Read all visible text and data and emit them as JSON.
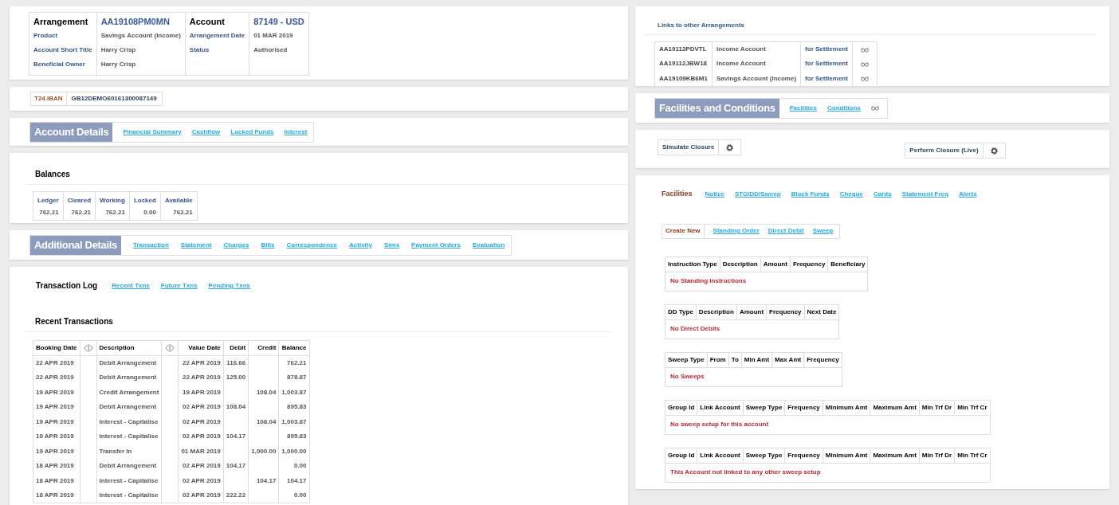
{
  "summary": {
    "blocks": [
      {
        "title": "Arrangement",
        "value": "AA19108PM0MN",
        "rows": [
          {
            "label": "Product",
            "value": "Savings Account (Income)"
          },
          {
            "label": "Account Short Title",
            "value": "Harry Crisp"
          },
          {
            "label": "Beneficial Owner",
            "value": "Harry Crisp"
          }
        ]
      },
      {
        "title": "Account",
        "value": "87149 - USD",
        "rows": [
          {
            "label": "Arrangement Date",
            "value": "01 MAR 2019"
          },
          {
            "label": "Status",
            "value": "Authorised"
          }
        ]
      }
    ]
  },
  "iban": {
    "label": "T24.IBAN",
    "value": "GB12DEMO60161300087149"
  },
  "account_details": {
    "title": "Account Details",
    "links": [
      "Financial Summary",
      "Cashflow",
      "Locked Funds",
      "Interest"
    ]
  },
  "balances": {
    "title": "Balances",
    "columns": [
      {
        "label": "Ledger",
        "value": "762.21"
      },
      {
        "label": "Cleared",
        "value": "762.21"
      },
      {
        "label": "Working",
        "value": "762.21"
      },
      {
        "label": "Locked",
        "value": "0.00"
      },
      {
        "label": "Available",
        "value": "762.21"
      }
    ]
  },
  "additional_details": {
    "title": "Additional Details",
    "links": [
      "Transaction",
      "Statement",
      "Charges",
      "Bills",
      "Correspondence",
      "Activity",
      "Sims",
      "Payment Orders",
      "Evaluation"
    ]
  },
  "transaction_log": {
    "title": "Transaction Log",
    "links": [
      "Recent Txns",
      "Future Txns",
      "Pending Txns"
    ],
    "recent": {
      "title": "Recent Transactions",
      "columns": {
        "booking_date": "Booking Date",
        "description": "Description",
        "value_date": "Value Date",
        "debit": "Debit",
        "credit": "Credit",
        "balance": "Balance"
      },
      "rows": [
        {
          "booking_date": "22 APR 2019",
          "description": "Debit Arrangement",
          "value_date": "22 APR 2019",
          "debit": "116.66",
          "balance": "762.21"
        },
        {
          "booking_date": "22 APR 2019",
          "description": "Debit Arrangement",
          "value_date": "22 APR 2019",
          "debit": "125.00",
          "balance": "878.87"
        },
        {
          "booking_date": "19 APR 2019",
          "description": "Credit Arrangement",
          "value_date": "19 APR 2019",
          "credit": "108.04",
          "balance": "1,003.87"
        },
        {
          "booking_date": "19 APR 2019",
          "description": "Debit Arrangement",
          "value_date": "02 APR 2019",
          "debit": "108.04",
          "balance": "895.83"
        },
        {
          "booking_date": "19 APR 2019",
          "description": "Interest - Capitalise",
          "value_date": "02 APR 2019",
          "credit": "108.04",
          "balance": "1,003.87"
        },
        {
          "booking_date": "19 APR 2019",
          "description": "Interest - Capitalise",
          "value_date": "02 APR 2019",
          "debit": "104.17",
          "balance": "895.83"
        },
        {
          "booking_date": "19 APR 2019",
          "description": "Transfer In",
          "value_date": "01 MAR 2019",
          "credit": "1,000.00",
          "balance": "1,000.00"
        },
        {
          "booking_date": "18 APR 2019",
          "description": "Debit Arrangement",
          "value_date": "02 APR 2019",
          "debit": "104.17",
          "balance": "0.00"
        },
        {
          "booking_date": "18 APR 2019",
          "description": "Interest - Capitalise",
          "value_date": "02 APR 2019",
          "credit": "104.17",
          "balance": "104.17"
        },
        {
          "booking_date": "18 APR 2019",
          "description": "Interest - Capitalise",
          "value_date": "02 APR 2019",
          "debit": "222.22",
          "balance": "0.00"
        }
      ]
    }
  },
  "linked_arrangements": {
    "title": "Links to other Arrangements",
    "rows": [
      {
        "arrangement": "AA19112PDVTL",
        "product": "Income Account",
        "role": "for Settlement"
      },
      {
        "arrangement": "AA19112JBW18",
        "product": "Income Account",
        "role": "for Settlement"
      },
      {
        "arrangement": "AA19109KB6M1",
        "product": "Savings Account (Income)",
        "role": "for Settlement"
      }
    ]
  },
  "facilities_conditions": {
    "title": "Facilities and Conditions",
    "links": [
      "Facilities",
      "Conditions"
    ]
  },
  "closure": {
    "buttons": [
      "Simulate Closure",
      "Perform Closure (Live)"
    ]
  },
  "facilities": {
    "title": "Facilities",
    "links": [
      "Notice",
      "STO/DD/Sweep",
      "Block Funds",
      "Cheque",
      "Cards",
      "Statement Freq",
      "Alerts"
    ],
    "create_new": {
      "label": "Create New",
      "links": [
        "Standing Order",
        "Direct Debit",
        "Sweep"
      ]
    },
    "tables": [
      {
        "columns": [
          "Instruction Type",
          "Description",
          "Amount",
          "Frequency",
          "Beneficiary"
        ],
        "message": "No Standing Instructions"
      },
      {
        "columns": [
          "DD Type",
          "Description",
          "Amount",
          "Frequency",
          "Next Date"
        ],
        "message": "No Direct Debits"
      },
      {
        "columns": [
          "Sweep Type",
          "From",
          "To",
          "Min Amt",
          "Max Amt",
          "Frequency"
        ],
        "message": "No Sweeps"
      },
      {
        "columns": [
          "Group Id",
          "Link Account",
          "Sweep Type",
          "Frequency",
          "Minimum Amt",
          "Maximum Amt",
          "Min Trf Dr",
          "Min Trf Cr"
        ],
        "message": "No sweep setup for this account"
      },
      {
        "columns": [
          "Group Id",
          "Link Account",
          "Sweep Type",
          "Frequency",
          "Minimum Amt",
          "Maximum Amt",
          "Min Trf Dr",
          "Min Trf Cr"
        ],
        "message": "This Account not linked to any other sweep setup"
      }
    ]
  }
}
